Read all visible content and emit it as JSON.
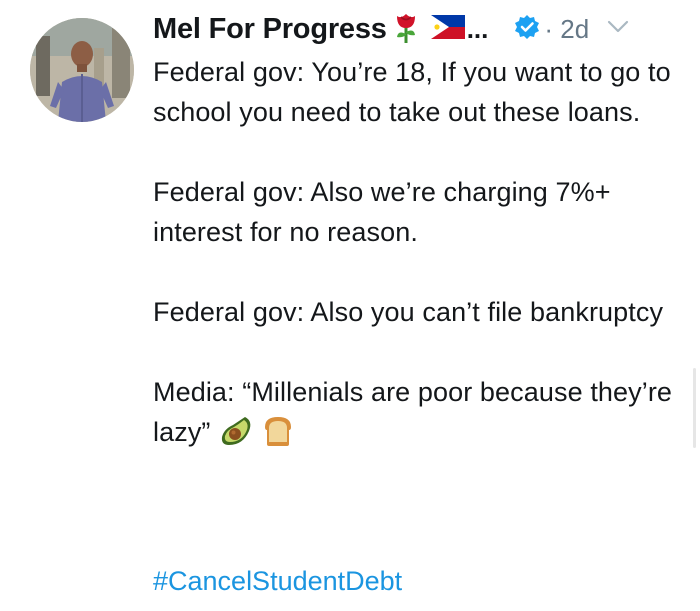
{
  "tweet": {
    "author": {
      "display_name": "Mel For Progress",
      "name_emojis": [
        "rose-emoji",
        "philippines-flag-emoji"
      ],
      "truncation": "...",
      "verified": true
    },
    "timestamp_prefix": "·",
    "timestamp": "2d",
    "paragraphs": [
      "Federal gov: You’re 18, If you want to go to school you need to take out these loans.",
      "Federal gov: Also we’re charging 7%+ interest for no reason.",
      "Federal gov: Also you can’t file bankruptcy",
      "Media: “Millenials are poor because they’re lazy”"
    ],
    "trailing_emojis": [
      "avocado-emoji",
      "bread-emoji"
    ],
    "hashtag": "#CancelStudentDebt"
  },
  "colors": {
    "text": "#14171a",
    "muted": "#657786",
    "link": "#1b95e0",
    "verified": "#1da1f2"
  }
}
